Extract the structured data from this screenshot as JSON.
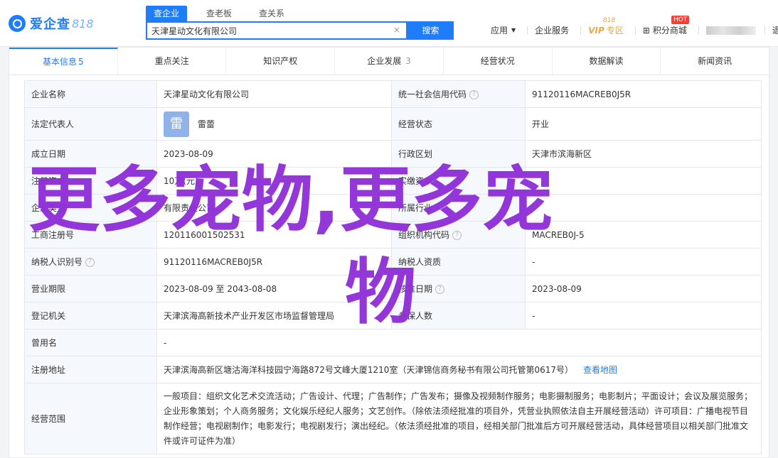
{
  "header": {
    "logo_text": "爱企查",
    "logo_sub": "818",
    "search_tabs": [
      "查企业",
      "查老板",
      "查关系"
    ],
    "search_value": "天津星动文化有限公司",
    "search_clear": "×",
    "search_button": "搜索",
    "nav": {
      "apply": "应用",
      "service": "企业服务",
      "vip": "VIP",
      "vip_zone": "专区",
      "vip_tag": "818",
      "points": "积分商城",
      "hot": "HOT",
      "logout": "退出"
    }
  },
  "tabs": [
    {
      "label": "基本信息",
      "count": "5"
    },
    {
      "label": "重点关注",
      "count": ""
    },
    {
      "label": "知识产权",
      "count": ""
    },
    {
      "label": "企业发展",
      "count": "3"
    },
    {
      "label": "经营状况",
      "count": ""
    },
    {
      "label": "数据解读",
      "count": ""
    },
    {
      "label": "新闻资讯",
      "count": ""
    }
  ],
  "info": {
    "company_name_label": "企业名称",
    "company_name": "天津星动文化有限公司",
    "credit_code_label": "统一社会信用代码",
    "credit_code": "91120116MACREB0J5R",
    "legal_rep_label": "法定代表人",
    "legal_rep_avatar": "雷",
    "legal_rep": "雷蕾",
    "status_label": "经营状态",
    "status": "开业",
    "established_label": "成立日期",
    "established": "2023-08-09",
    "region_label": "行政区划",
    "region": "天津市滨海新区",
    "reg_capital_label": "注册资本",
    "reg_capital": "10万(元)",
    "paid_capital_label": "实缴资本",
    "paid_capital": "",
    "company_type_label": "企业类型",
    "company_type": "有限责任公司",
    "industry_label": "所属行业",
    "industry": "",
    "biz_reg_no_label": "工商注册号",
    "biz_reg_no": "120116001502531",
    "org_code_label": "组织机构代码",
    "org_code": "MACREB0J-5",
    "taxpayer_id_label": "纳税人识别号",
    "taxpayer_id": "91120116MACREB0J5R",
    "taxpayer_quali_label": "纳税人资质",
    "taxpayer_quali": "-",
    "term_label": "营业期限",
    "term": "2023-08-09 至 2043-08-08",
    "approval_date_label": "核准日期",
    "approval_date": "2023-08-09",
    "authority_label": "登记机关",
    "authority": "天津滨海高新技术产业开发区市场监督管理局",
    "insured_label": "参保人数",
    "insured": "-",
    "former_name_label": "曾用名",
    "former_name": "-",
    "address_label": "注册地址",
    "address": "天津滨海高新区塘沽海洋科技园宁海路872号文峰大厦1210室（天津锦信商务秘书有限公司托管第0617号）",
    "map_link": "查看地图",
    "scope_label": "经营范围",
    "scope": "一般项目：组织文化艺术交流活动；广告设计、代理；广告制作；广告发布；摄像及视频制作服务；电影摄制服务；电影制片；平面设计；会议及展览服务；企业形象策划；个人商务服务；文化娱乐经纪人服务；文艺创作。（除依法须经批准的项目外，凭营业执照依法自主开展经营活动）许可项目：广播电视节目制作经营；电视剧制作；电影发行；电视剧发行；演出经纪。（依法须经批准的项目，经相关部门批准后方可开展经营活动，具体经营项目以相关部门批准文件或许可证件为准）",
    "help_glyph": "?"
  },
  "watermark": {
    "line1": "更多宠物,更多宠",
    "line2": "物",
    "color": "#8f2fd8"
  }
}
